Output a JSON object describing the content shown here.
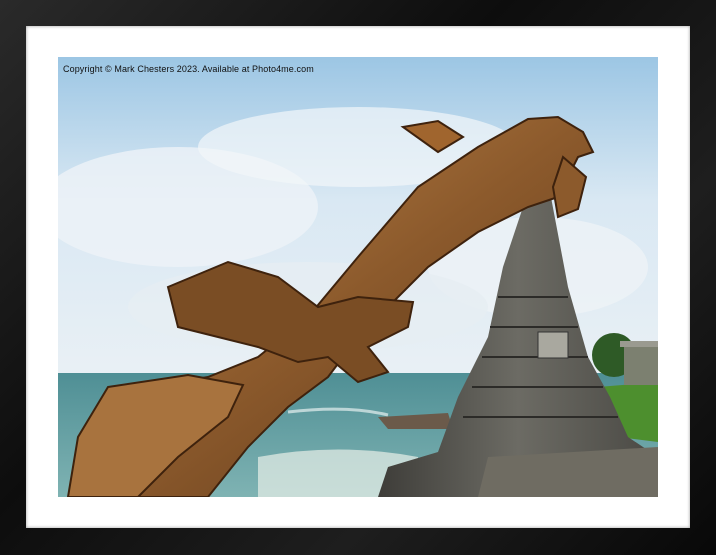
{
  "photo": {
    "copyright": "Copyright © Mark Chesters 2023. Available at Photo4me.com",
    "subject": "dolphin-sculpture"
  },
  "colors": {
    "frame": "#141414",
    "mount": "#ffffff",
    "sky": "#cfe2f1",
    "sea": "#5d9aa0",
    "wood": "#8a5a2e",
    "stone": "#5b5a55"
  }
}
